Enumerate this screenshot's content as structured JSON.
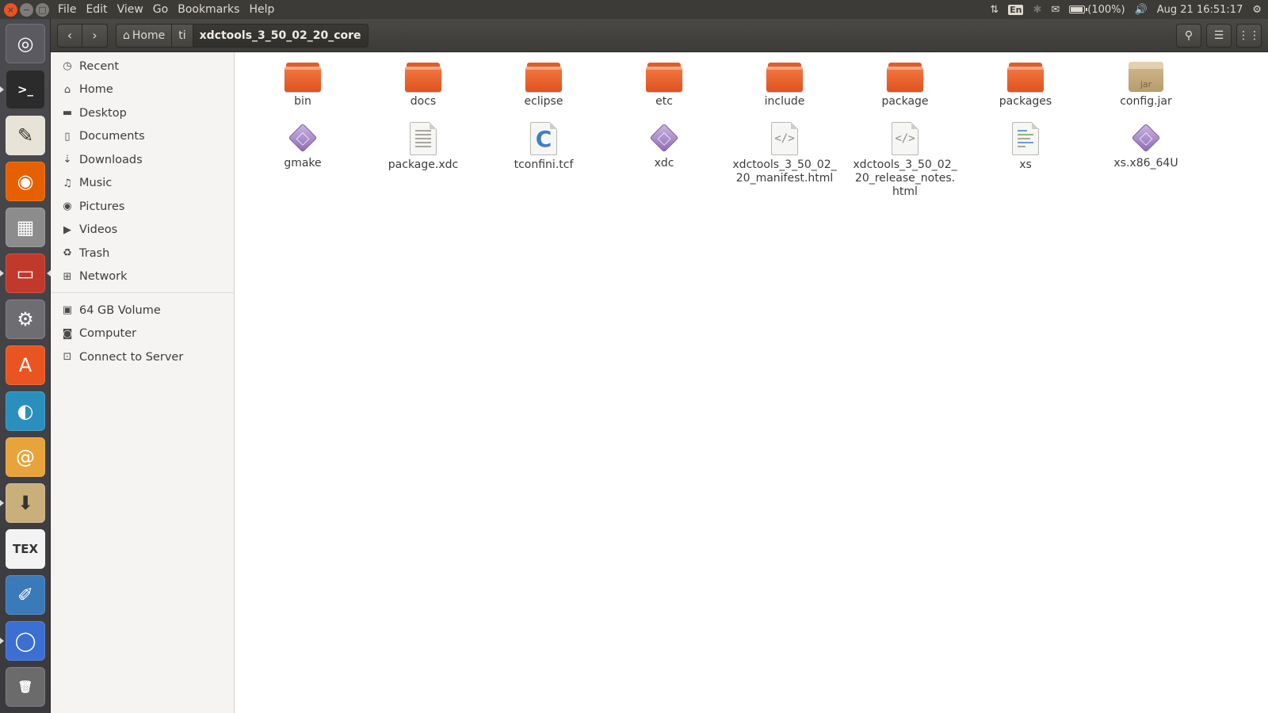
{
  "window_controls": {
    "close": "×",
    "minimize": "−",
    "maximize": "□"
  },
  "menu": [
    "File",
    "Edit",
    "View",
    "Go",
    "Bookmarks",
    "Help"
  ],
  "indicators": {
    "language": "En",
    "battery_text": "(100%)",
    "battery_level": 1.0,
    "datetime": "Aug 21 16:51:17"
  },
  "launcher": [
    {
      "name": "ubuntu-dash-icon",
      "glyph": "◎",
      "color": "#5a5a60"
    },
    {
      "name": "terminal-icon",
      "glyph": ">_",
      "color": "#2b2b2b"
    },
    {
      "name": "text-editor-icon",
      "glyph": "✎",
      "color": "#e7e3d6"
    },
    {
      "name": "firefox-icon",
      "glyph": "◉",
      "color": "#e66000"
    },
    {
      "name": "cube-app-icon",
      "glyph": "▦",
      "color": "#8c8c8c"
    },
    {
      "name": "files-icon",
      "glyph": "▭",
      "color": "#c0392b"
    },
    {
      "name": "system-settings-icon",
      "glyph": "⚙",
      "color": "#6d6d72"
    },
    {
      "name": "software-center-icon",
      "glyph": "A",
      "color": "#e95420"
    },
    {
      "name": "octave-icon",
      "glyph": "◐",
      "color": "#2a8fbd"
    },
    {
      "name": "spiral-app-icon",
      "glyph": "@",
      "color": "#e8a33a"
    },
    {
      "name": "archive-manager-icon",
      "glyph": "⬇",
      "color": "#c9b07b"
    },
    {
      "name": "tex-icon",
      "glyph": "TEX",
      "color": "#f3f3f3"
    },
    {
      "name": "drawing-app-icon",
      "glyph": "✐",
      "color": "#3a7ab8"
    },
    {
      "name": "chromium-icon",
      "glyph": "◯",
      "color": "#3b6fd1"
    },
    {
      "name": "trash-launcher-icon",
      "glyph": "🗑",
      "color": "#6b6b6b"
    }
  ],
  "pathbar": {
    "home": "Home",
    "ti": "ti",
    "current": "xdctools_3_50_02_20_core"
  },
  "sidebar": {
    "places": [
      {
        "id": "recent",
        "label": "Recent",
        "icon": "◷"
      },
      {
        "id": "home",
        "label": "Home",
        "icon": "⌂"
      },
      {
        "id": "desktop",
        "label": "Desktop",
        "icon": "▬"
      },
      {
        "id": "documents",
        "label": "Documents",
        "icon": "▯"
      },
      {
        "id": "downloads",
        "label": "Downloads",
        "icon": "⇣"
      },
      {
        "id": "music",
        "label": "Music",
        "icon": "♫"
      },
      {
        "id": "pictures",
        "label": "Pictures",
        "icon": "◉"
      },
      {
        "id": "videos",
        "label": "Videos",
        "icon": "▶"
      },
      {
        "id": "trash",
        "label": "Trash",
        "icon": "♻"
      },
      {
        "id": "network",
        "label": "Network",
        "icon": "⊞"
      }
    ],
    "devices": [
      {
        "id": "volume",
        "label": "64 GB Volume",
        "icon": "▣"
      },
      {
        "id": "computer",
        "label": "Computer",
        "icon": "◙"
      },
      {
        "id": "connect",
        "label": "Connect to Server",
        "icon": "⊡"
      }
    ]
  },
  "files": [
    {
      "name": "bin",
      "type": "folder"
    },
    {
      "name": "docs",
      "type": "folder"
    },
    {
      "name": "eclipse",
      "type": "folder"
    },
    {
      "name": "etc",
      "type": "folder"
    },
    {
      "name": "include",
      "type": "folder"
    },
    {
      "name": "package",
      "type": "folder"
    },
    {
      "name": "packages",
      "type": "folder"
    },
    {
      "name": "config.jar",
      "type": "jar",
      "badge": "jar"
    },
    {
      "name": "gmake",
      "type": "executable"
    },
    {
      "name": "package.xdc",
      "type": "text"
    },
    {
      "name": "tconfini.tcf",
      "type": "c-source",
      "badge": "C"
    },
    {
      "name": "xdc",
      "type": "executable"
    },
    {
      "name": "xdctools_3_50_02_20_manifest.html",
      "type": "html",
      "badge": "</>"
    },
    {
      "name": "xdctools_3_50_02_20_release_notes.html",
      "type": "html",
      "badge": "</>"
    },
    {
      "name": "xs",
      "type": "script"
    },
    {
      "name": "xs.x86_64U",
      "type": "executable"
    }
  ]
}
